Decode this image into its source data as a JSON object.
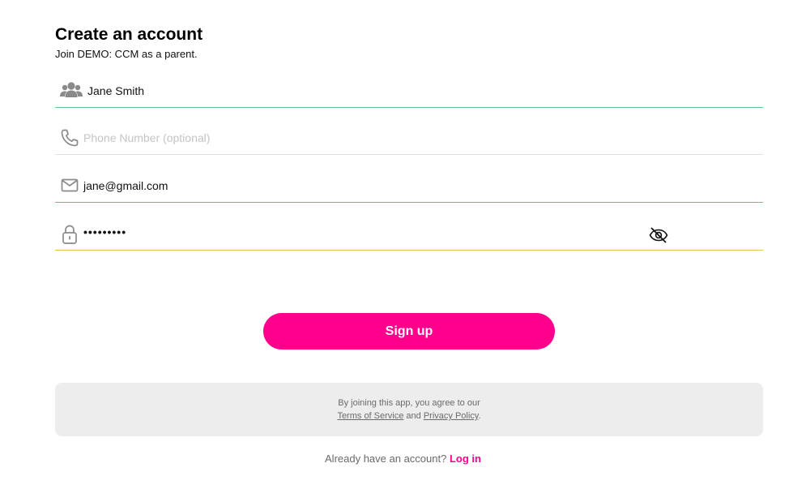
{
  "header": {
    "title": "Create an account",
    "subtitle": "Join DEMO: CCM as a parent."
  },
  "form": {
    "name": {
      "icon": "users-icon",
      "value": "Jane Smith"
    },
    "phone": {
      "icon": "phone-icon",
      "placeholder": "Phone Number (optional)",
      "value": ""
    },
    "email": {
      "icon": "envelope-icon",
      "value": "jane@gmail.com"
    },
    "password": {
      "icon": "lock-icon",
      "masked_value": "•••••••••",
      "toggle_icon": "eye-slash-icon"
    }
  },
  "actions": {
    "signup_label": "Sign up"
  },
  "terms": {
    "line1": "By joining this app, you agree to our",
    "terms_link": "Terms of Service",
    "and_text": "and",
    "privacy_link": "Privacy Policy",
    "end_period": "."
  },
  "login": {
    "prompt": "Already have an account?",
    "link_label": "Log in"
  },
  "colors": {
    "accent": "#ff008c",
    "valid_underline": "#5cc98a",
    "focus_underline": "#e2c64a",
    "terms_bg": "#ededed"
  }
}
